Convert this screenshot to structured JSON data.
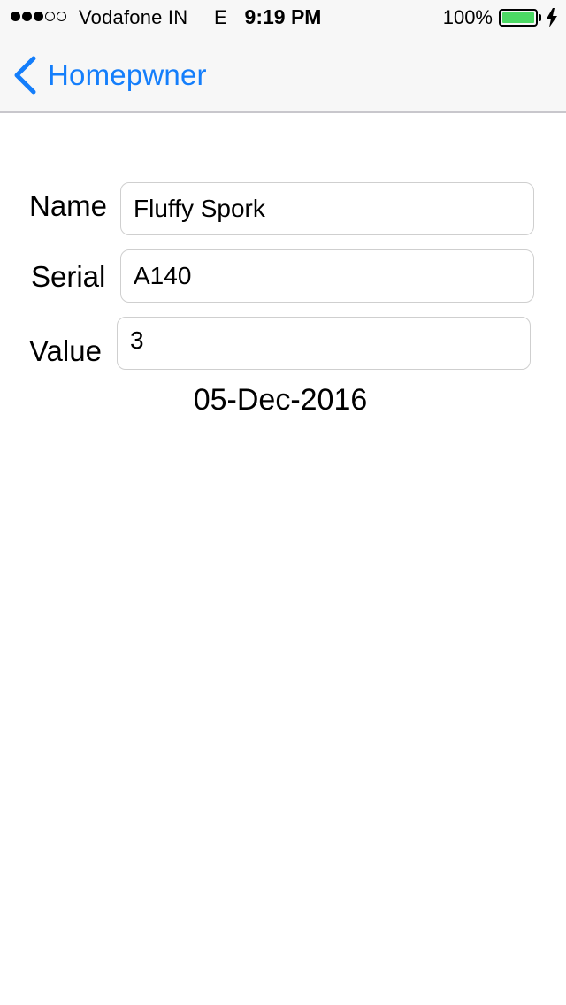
{
  "status_bar": {
    "carrier": "Vodafone IN",
    "network": "E",
    "time": "9:19 PM",
    "battery_percent": "100%",
    "battery_color": "#4cd964",
    "signal_bars_filled": 3,
    "signal_bars_total": 5
  },
  "nav": {
    "back_label": "Homepwner",
    "back_icon": "chevron-left-icon",
    "accent_color": "#147efb"
  },
  "form": {
    "name_label": "Name",
    "name_value": "Fluffy Spork",
    "serial_label": "Serial",
    "serial_value": "A140",
    "value_label": "Value",
    "value_value": "3"
  },
  "date_created": "05-Dec-2016"
}
